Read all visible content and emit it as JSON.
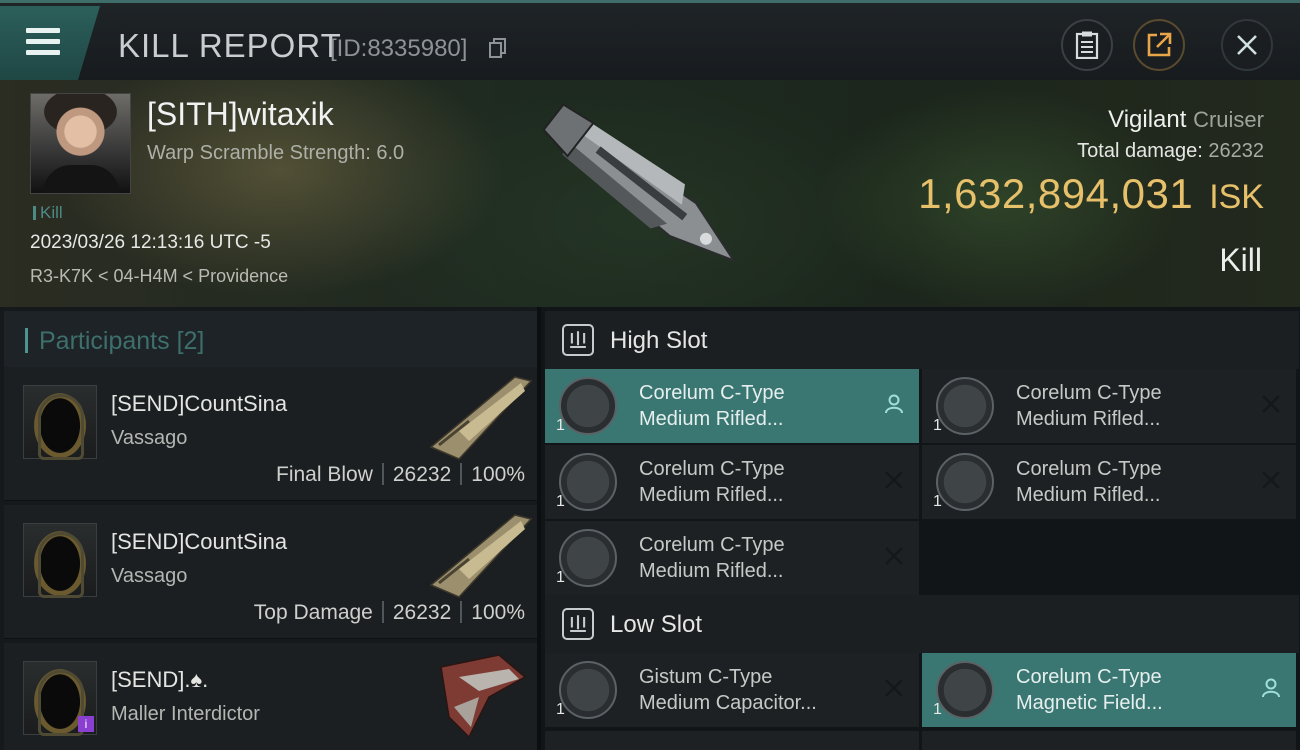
{
  "header": {
    "title": "KILL REPORT",
    "report_id": "[ID:8335980]"
  },
  "victim": {
    "name": "[SITH]witaxik",
    "warp_scramble": "Warp Scramble Strength: 6.0",
    "tag": "Kill",
    "datetime": "2023/03/26 12:13:16 UTC -5",
    "location": "R3-K7K < 04-H4M < Providence",
    "ship_name": "Vigilant",
    "ship_class": "Cruiser",
    "damage_label": "Total damage:",
    "damage_value": "26232",
    "isk_value": "1,632,894,031",
    "isk_unit": "ISK",
    "result": "Kill"
  },
  "participants": {
    "label": "Participants",
    "count": "[2]",
    "items": [
      {
        "name": "[SEND]CountSina",
        "ship": "Vassago",
        "role": "Final Blow",
        "damage": "26232",
        "percent": "100%"
      },
      {
        "name": "[SEND]CountSina",
        "ship": "Vassago",
        "role": "Top Damage",
        "damage": "26232",
        "percent": "100%"
      },
      {
        "name": "[SEND].♠.",
        "ship": "Maller Interdictor",
        "badge": "i"
      }
    ]
  },
  "slots": {
    "high": {
      "title": "High Slot",
      "modules": [
        {
          "line1": "Corelum C-Type",
          "line2": "Medium Rifled...",
          "qty": "1",
          "state": "fitted"
        },
        {
          "line1": "Corelum C-Type",
          "line2": "Medium Rifled...",
          "qty": "1",
          "state": "destroyed"
        },
        {
          "line1": "Corelum C-Type",
          "line2": "Medium Rifled...",
          "qty": "1",
          "state": "destroyed"
        },
        {
          "line1": "Corelum C-Type",
          "line2": "Medium Rifled...",
          "qty": "1",
          "state": "destroyed"
        },
        {
          "line1": "Corelum C-Type",
          "line2": "Medium Rifled...",
          "qty": "1",
          "state": "destroyed"
        }
      ]
    },
    "low": {
      "title": "Low Slot",
      "modules": [
        {
          "line1": "Gistum C-Type",
          "line2": "Medium Capacitor...",
          "qty": "1",
          "state": "destroyed"
        },
        {
          "line1": "Corelum C-Type",
          "line2": "Magnetic Field...",
          "qty": "1",
          "state": "fitted"
        }
      ]
    }
  },
  "colors": {
    "accent": "#3a7772",
    "isk_gold": "#e6c06a",
    "participants_label": "#3e6f6c"
  }
}
